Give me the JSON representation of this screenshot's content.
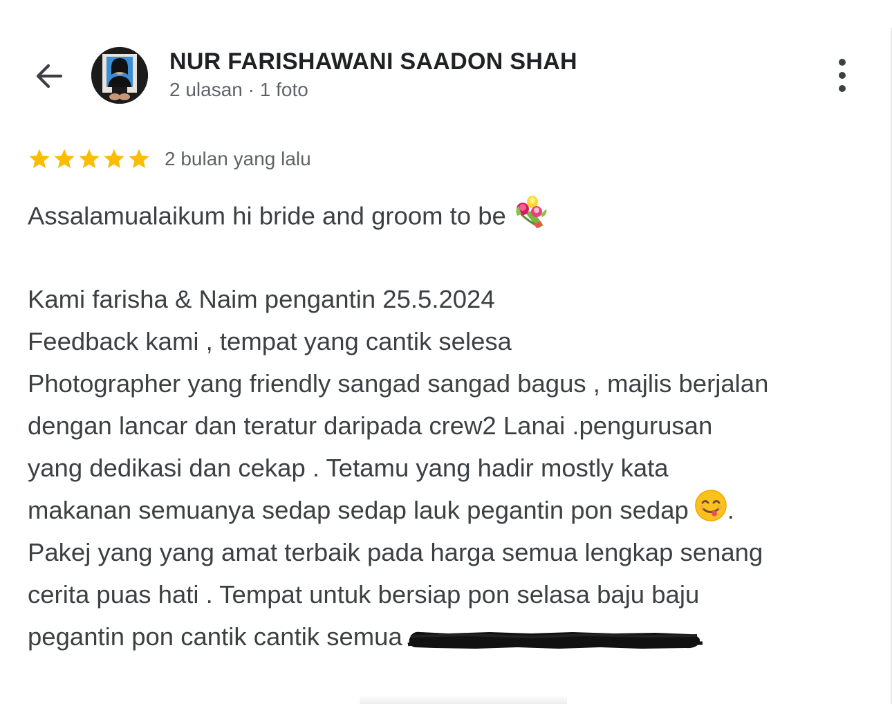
{
  "header": {
    "back_icon": "arrow-back-icon",
    "user_name": "NUR FARISHAWANI SAADON SHAH",
    "user_meta": "2 ulasan · 1 foto",
    "more_icon": "more-vert-icon"
  },
  "rating": {
    "stars": 5,
    "max_stars": 5,
    "star_color": "#fbbc04",
    "time_ago": "2 bulan yang lalu"
  },
  "review": {
    "line1": "Assalamualaikum hi bride and groom to be",
    "line1_emoji": "bouquet-emoji",
    "line2": "Kami farisha & Naim pengantin 25.5.2024",
    "line3": "Feedback kami , tempat yang cantik selesa",
    "line4": "Photographer yang friendly sangad sangad bagus , majlis berjalan",
    "line5": "dengan lancar dan teratur daripada crew2 Lanai .pengurusan",
    "line6": "yang dedikasi dan cekap . Tetamu yang hadir mostly kata",
    "line7": "makanan semuanya sedap sedap lauk pegantin pon sedap",
    "line7_emoji": "yum-face-emoji",
    "line7_end": ".",
    "line8": "Pakej yang yang amat terbaik pada harga semua lengkap senang",
    "line9": "cerita puas hati . Tempat untuk bersiap pon selasa baju baju",
    "line10": "pegantin pon cantik cantik semua",
    "redaction": "redacted-scribble"
  },
  "colors": {
    "name_text": "#202124",
    "body_text": "#3c4043",
    "meta_text": "#5f6368",
    "star": "#fbbc04"
  }
}
